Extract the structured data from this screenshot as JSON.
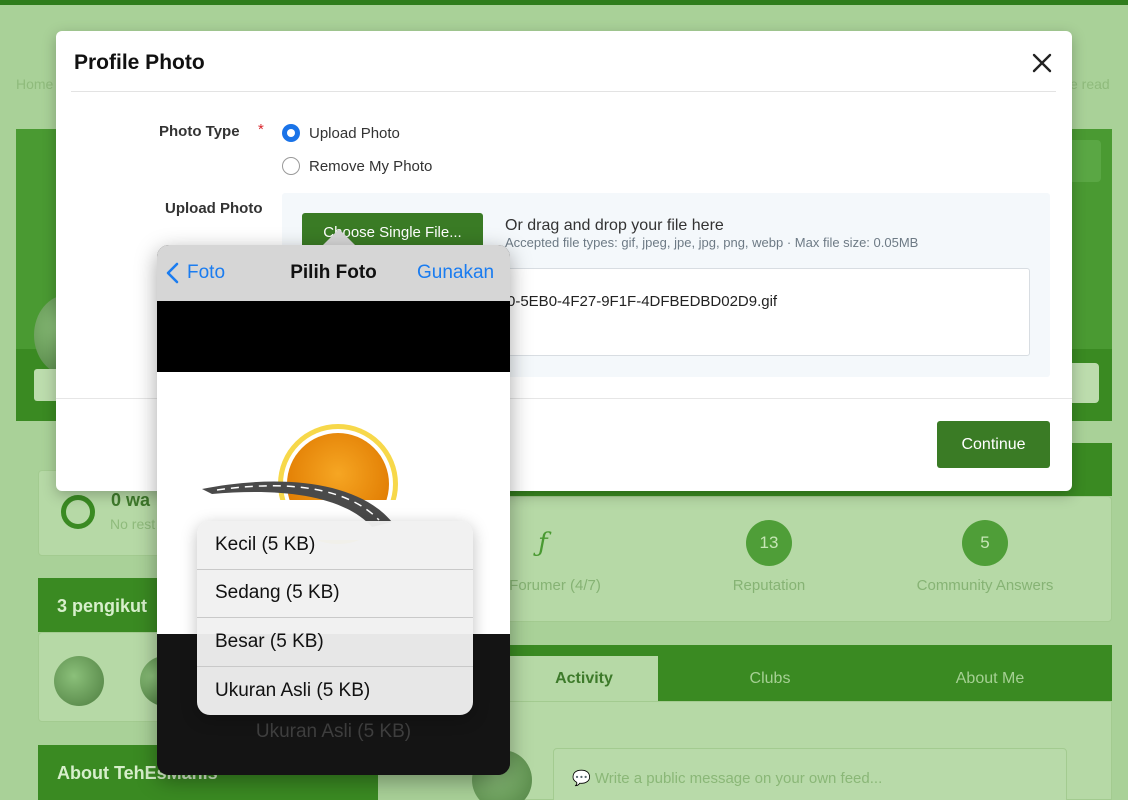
{
  "background": {
    "breadcrumb_home": "Home",
    "right_hint": "e read",
    "status_title": "0 wa",
    "status_sub": "No rest",
    "followers_title": "3 pengikut",
    "about_title": "About TehEsManis",
    "stats": [
      {
        "value": "",
        "label": "Forumer (4/7)"
      },
      {
        "value": "13",
        "label": "Reputation"
      },
      {
        "value": "5",
        "label": "Community Answers"
      }
    ],
    "tabs": [
      "Activity",
      "Clubs",
      "About Me"
    ],
    "feed_placeholder": "Write a public message on your own feed..."
  },
  "modal": {
    "title": "Profile Photo",
    "photo_type_label": "Photo Type",
    "required_mark": "*",
    "options": [
      "Upload Photo",
      "Remove My Photo"
    ],
    "selected_option": "Upload Photo",
    "upload_label": "Upload Photo",
    "choose_button": "Choose Single File...",
    "drag_text": "Or drag and drop your file here",
    "accepted_text": "Accepted file types: gif, jpeg, jpe, jpg, png, webp · Max file size: 0.05MB",
    "file_name": "0-5EB0-4F27-9F1F-4DFBEDBD02D9.gif",
    "continue_button": "Continue"
  },
  "picker": {
    "back_label": "Foto",
    "title": "Pilih Foto",
    "use_label": "Gunakan",
    "size_options": [
      "Kecil (5 KB)",
      "Sedang (5 KB)",
      "Besar (5 KB)",
      "Ukuran Asli (5 KB)"
    ],
    "ghost_option": "Ukuran Asli (5 KB)",
    "accent_color": "#1a7cf0"
  },
  "colors": {
    "brand_green": "#3a7b25",
    "radio_selected": "#1a73e8",
    "required": "#d9262c"
  }
}
